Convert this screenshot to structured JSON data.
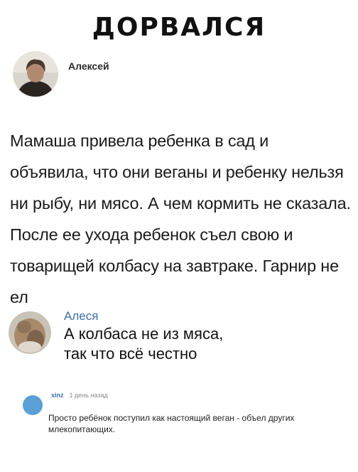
{
  "title": "ДОРВАЛСЯ",
  "post": {
    "author": "Алексей",
    "text": "Мамаша привела ребенка в сад и объявила, что они веганы и ребенку нельзя ни рыбу, ни мясо. А чем кормить не сказала. После ее ухода ребенок съел свою и товарищей колбасу на завтраке. Гарнир не ел"
  },
  "comment1": {
    "author": "Алеся",
    "text": "А колбаса не из мяса,\nтак что всё честно"
  },
  "comment2": {
    "user": "xinz",
    "time": "1 день назад",
    "text": "Просто ребёнок поступил как настоящий веган - объел других млекопитающих."
  },
  "colors": {
    "link_blue": "#3c6fa8",
    "avatar_blue": "#5a9fd6"
  }
}
